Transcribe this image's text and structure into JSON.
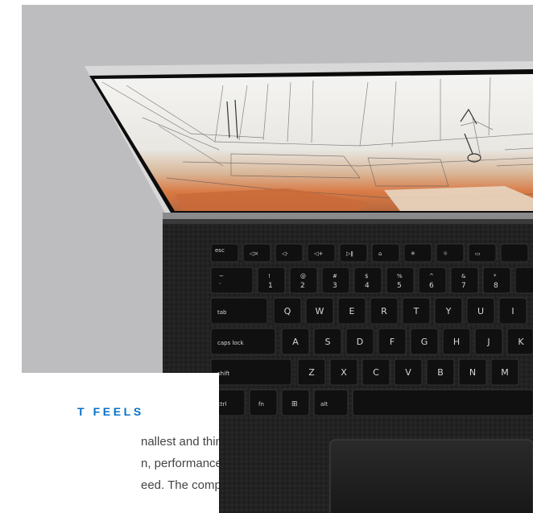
{
  "hero": {
    "image": "laptop-top-view",
    "keyboard": {
      "row_function": [
        "esc",
        "F1",
        "F2",
        "F3",
        "F4",
        "F5",
        "F6",
        "F7",
        "F8",
        "F9"
      ],
      "row_function_sub": [
        "",
        "F1",
        "F2",
        "F3",
        "F4",
        "F5",
        "F6",
        "F7",
        "F8",
        "F9"
      ],
      "row_numbers_top": [
        "~",
        "!",
        "@",
        "#",
        "$",
        "%",
        "^",
        "&",
        "*"
      ],
      "row_numbers_bottom": [
        "`",
        "1",
        "2",
        "3",
        "4",
        "5",
        "6",
        "7",
        "8"
      ],
      "row_qwerty": [
        "tab",
        "Q",
        "W",
        "E",
        "R",
        "T",
        "Y",
        "U",
        "I"
      ],
      "row_home": [
        "caps lock",
        "A",
        "S",
        "D",
        "F",
        "G",
        "H",
        "J",
        "K"
      ],
      "row_shift": [
        "shift",
        "Z",
        "X",
        "C",
        "V",
        "B",
        "N",
        "M"
      ],
      "row_bottom": [
        "ctrl",
        "fn",
        "⊞",
        "alt"
      ]
    }
  },
  "card": {
    "eyebrow": "T FEELS",
    "line1": "nallest and thinnest",
    "line2": "n, performance has",
    "line3": "eed. The compact"
  }
}
